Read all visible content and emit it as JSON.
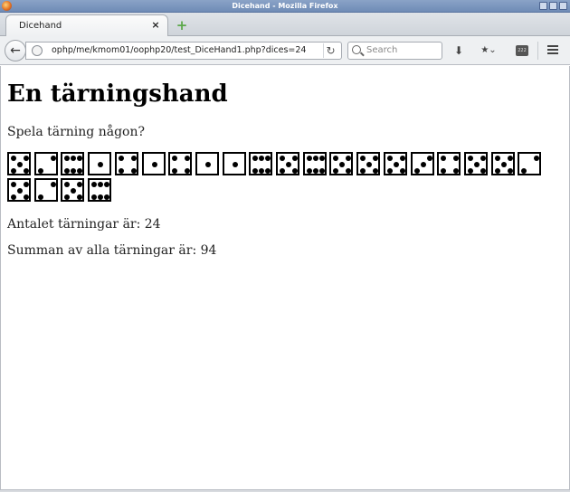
{
  "window": {
    "title": "Dicehand - Mozilla Firefox"
  },
  "tabs": [
    {
      "label": "Dicehand",
      "close": "×"
    }
  ],
  "newtab": {
    "label": "+"
  },
  "navbar": {
    "url": "ophp/me/kmom01/oophp20/test_DiceHand1.php?dices=24",
    "search_placeholder": "Search",
    "ext_label": "222"
  },
  "page": {
    "title": "En tärningshand",
    "intro": "Spela tärning någon?",
    "count_line": "Antalet tärningar är: 24",
    "sum_line": "Summan av alla tärningar är: 94"
  },
  "dice_values": [
    5,
    2,
    6,
    1,
    4,
    1,
    4,
    1,
    1,
    6,
    5,
    6,
    5,
    5,
    5,
    3,
    4,
    5,
    5,
    2,
    5,
    2,
    5,
    6
  ]
}
